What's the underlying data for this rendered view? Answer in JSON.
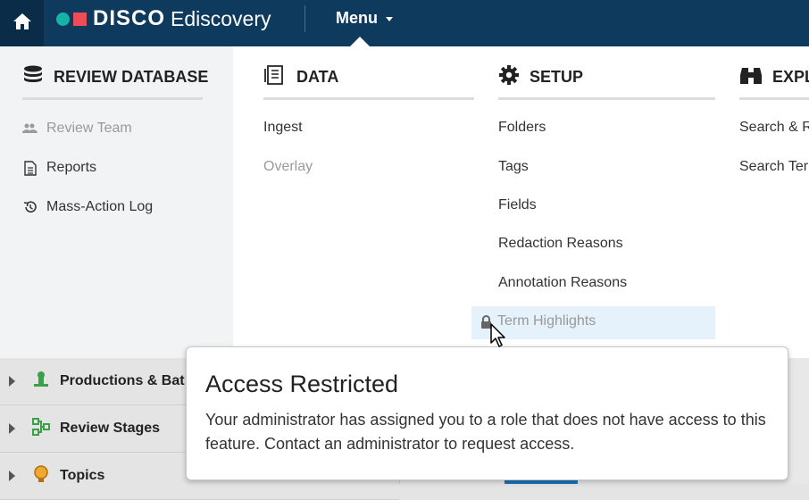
{
  "topbar": {
    "brand": "DISCO",
    "product": "Ediscovery",
    "menu_label": "Menu",
    "colors": {
      "bar": "#0e3a5e",
      "home": "#0a2c48",
      "teal": "#14b3a5",
      "coral": "#ee4c58"
    }
  },
  "menu": {
    "review_database": {
      "heading": "REVIEW DATABASE",
      "items": [
        {
          "label": "Review Team",
          "icon": "users-icon",
          "disabled": true
        },
        {
          "label": "Reports",
          "icon": "document-icon",
          "disabled": false
        },
        {
          "label": "Mass-Action Log",
          "icon": "history-icon",
          "disabled": false
        }
      ]
    },
    "data": {
      "heading": "DATA",
      "items": [
        {
          "label": "Ingest",
          "disabled": false
        },
        {
          "label": "Overlay",
          "disabled": true
        }
      ]
    },
    "setup": {
      "heading": "SETUP",
      "items": [
        {
          "label": "Folders"
        },
        {
          "label": "Tags"
        },
        {
          "label": "Fields"
        },
        {
          "label": "Redaction Reasons"
        },
        {
          "label": "Annotation Reasons"
        },
        {
          "label": "Term Highlights",
          "locked": true,
          "icon": "lock-icon"
        }
      ]
    },
    "explore": {
      "heading": "EXPL",
      "items": [
        {
          "label": "Search & R"
        },
        {
          "label": "Search Ter"
        }
      ]
    }
  },
  "background_list": [
    {
      "label": "Productions & Bat",
      "icon": "stamp-icon"
    },
    {
      "label": "Review Stages",
      "icon": "workflow-icon"
    },
    {
      "label": "Topics",
      "icon": "bulb-icon"
    }
  ],
  "tooltip": {
    "title": "Access Restricted",
    "body": "Your administrator has assigned you to a role that does not have access to this feature. Contact an administrator to request access."
  }
}
